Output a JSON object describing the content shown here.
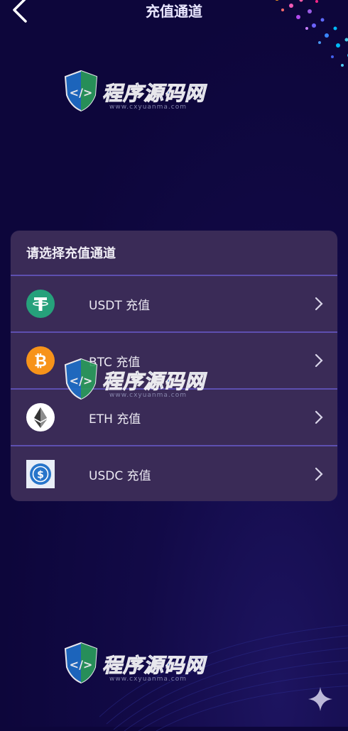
{
  "header": {
    "title": "充值通道"
  },
  "card": {
    "title": "请选择充值通道",
    "items": [
      {
        "label": "USDT 充值",
        "icon": "tether-icon",
        "color": "#26a17b"
      },
      {
        "label": "BTC 充值",
        "icon": "bitcoin-icon",
        "color": "#f7931a"
      },
      {
        "label": "ETH 充值",
        "icon": "ethereum-icon",
        "color": "#ffffff"
      },
      {
        "label": "USDC 充值",
        "icon": "usdc-icon",
        "color": "#2775ca"
      }
    ]
  },
  "watermark": {
    "name_part1": "程序",
    "name_part2": "源码网",
    "url": "www.cxyuanma.com"
  }
}
